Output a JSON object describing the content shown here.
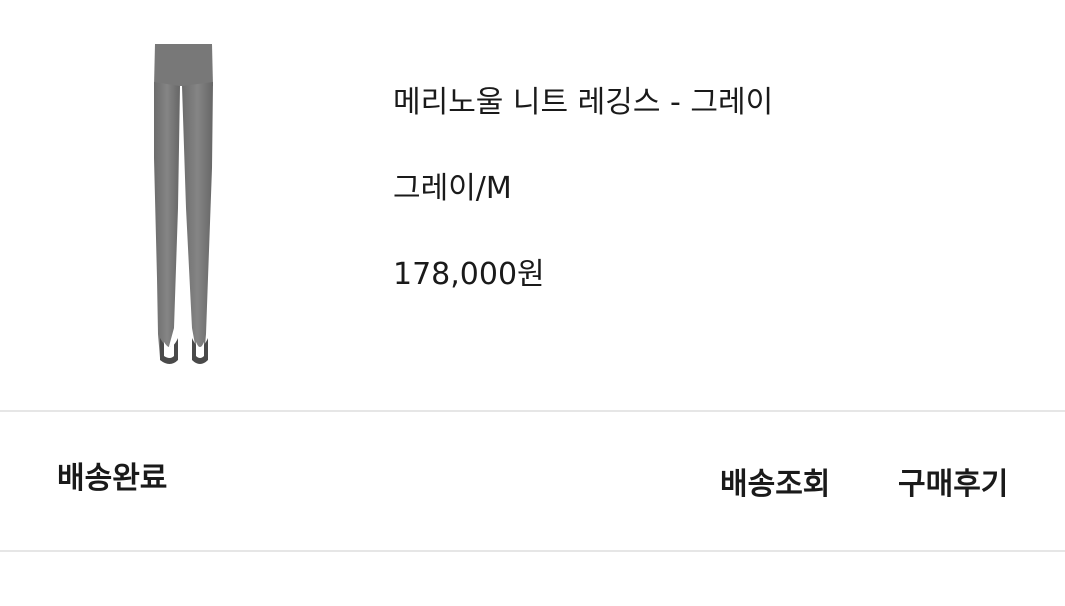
{
  "order_item": {
    "image_icon": "gray-stirrup-leggings-image",
    "name": "메리노울 니트 레깅스 - 그레이",
    "option": "그레이/M",
    "price": "178,000원"
  },
  "delivery": {
    "status": "배송완료",
    "track_label": "배송조회",
    "review_label": "구매후기"
  }
}
